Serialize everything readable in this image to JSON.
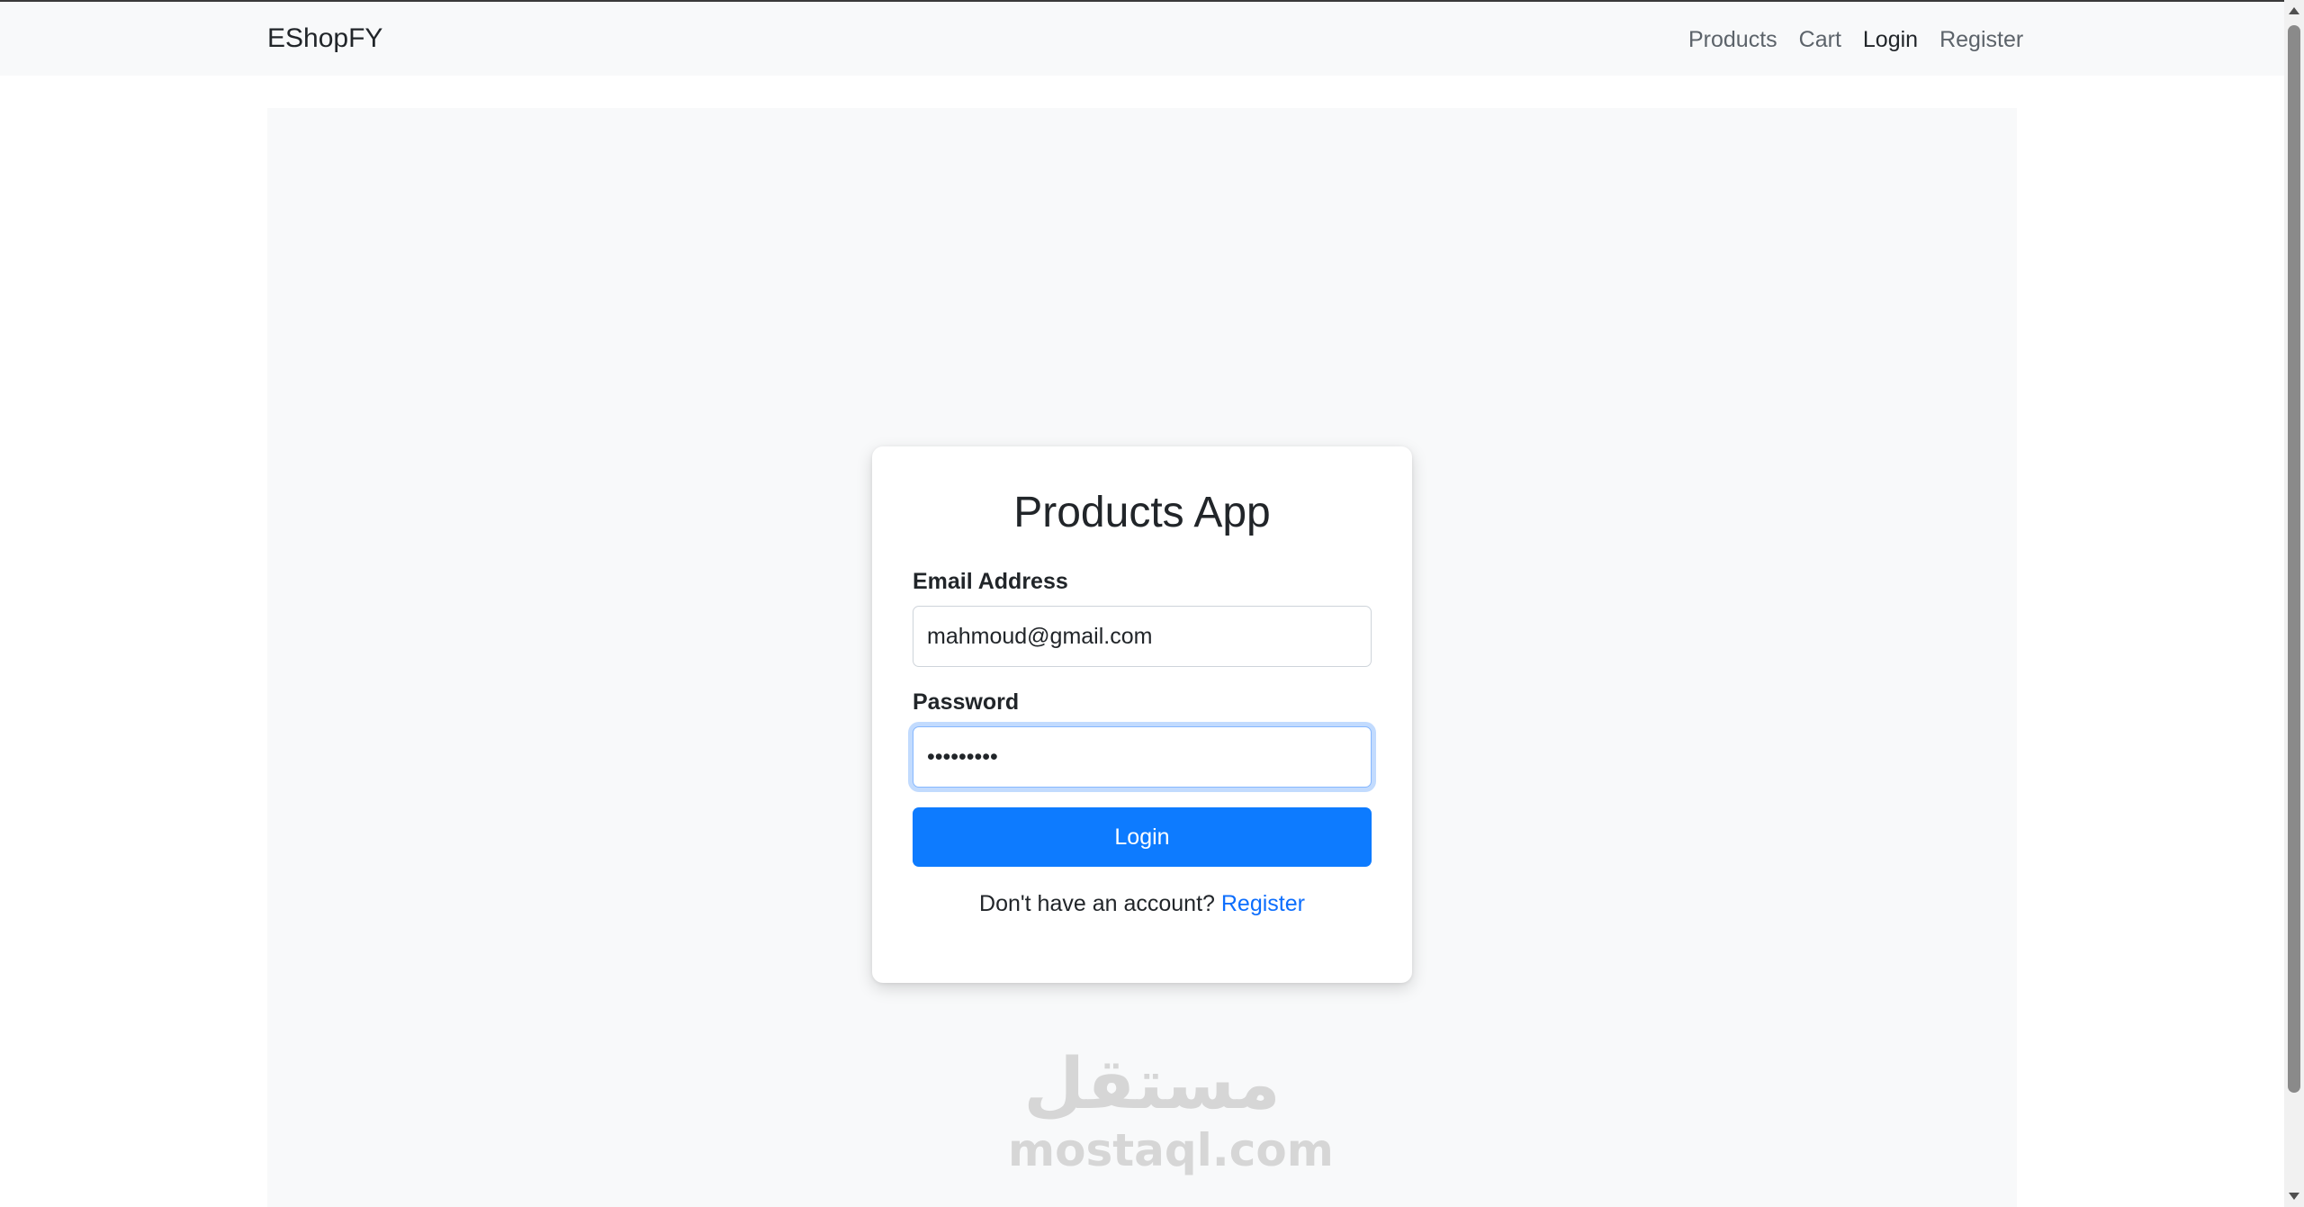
{
  "navbar": {
    "brand": "EShopFY",
    "links": [
      {
        "label": "Products",
        "active": false
      },
      {
        "label": "Cart",
        "active": false
      },
      {
        "label": "Login",
        "active": true
      },
      {
        "label": "Register",
        "active": false
      }
    ]
  },
  "login_card": {
    "title": "Products App",
    "email_label": "Email Address",
    "email_value": "mahmoud@gmail.com",
    "password_label": "Password",
    "password_value": "•••••••••",
    "submit_label": "Login",
    "register_prompt": "Don't have an account?",
    "register_link": "Register"
  },
  "watermark": {
    "arabic": "مستقل",
    "latin": "mostaql.com"
  },
  "colors": {
    "primary": "#0d7bff",
    "link": "#0d6efd",
    "navbar_bg": "#f8f9fa",
    "focus_ring": "#86b7fe"
  }
}
